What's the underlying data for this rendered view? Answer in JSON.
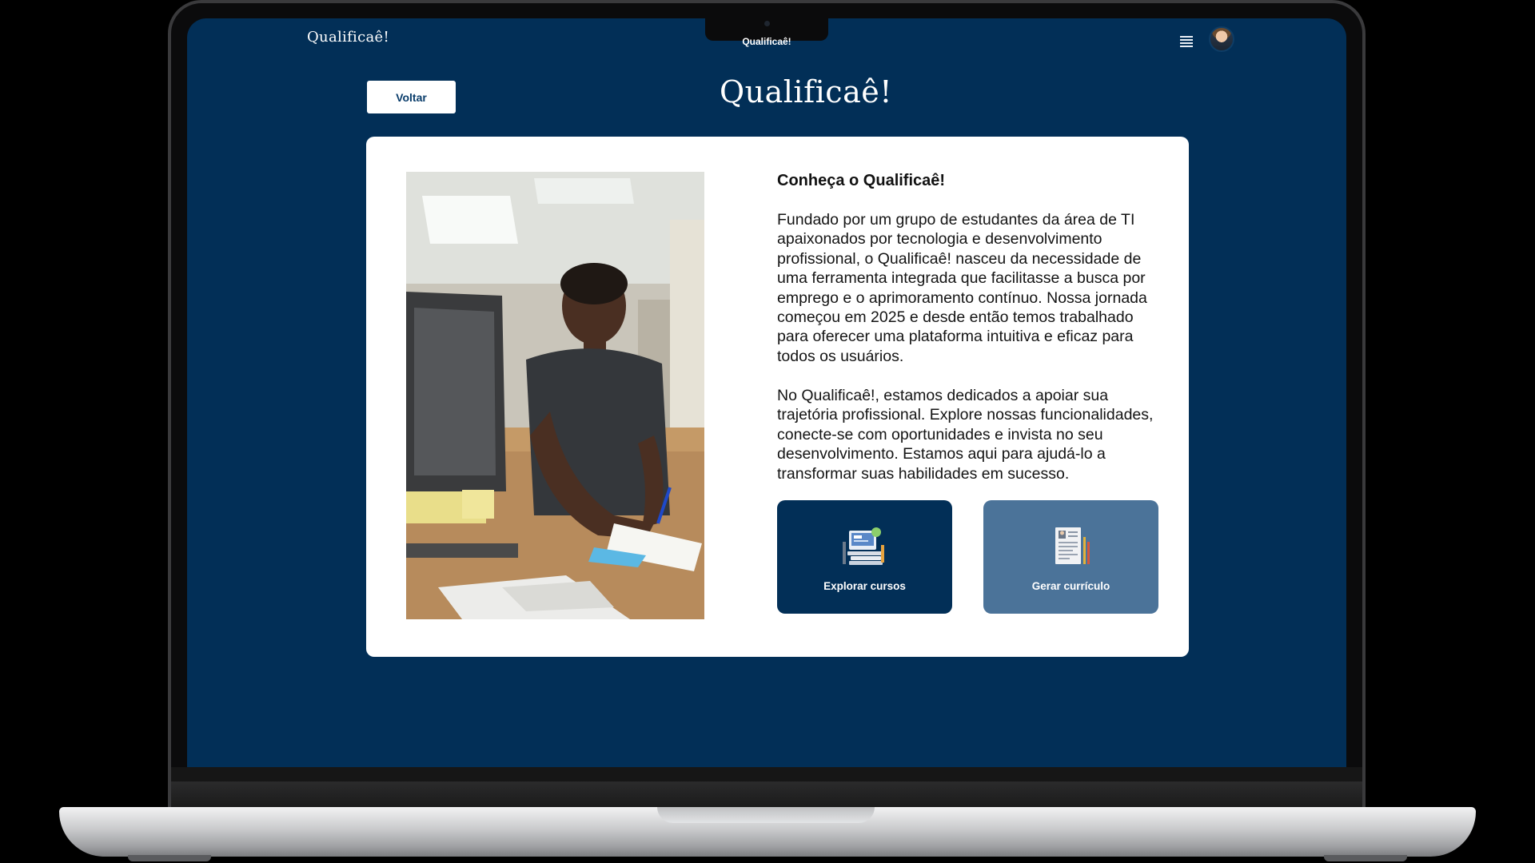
{
  "app": {
    "brand": "Qualificaê!",
    "window_title": "Qualificaê!"
  },
  "header": {
    "menu_icon": "hamburger-menu-icon",
    "avatar_icon": "user-avatar"
  },
  "nav": {
    "back_label": "Voltar"
  },
  "logo": {
    "text": "Qualificaê!"
  },
  "about": {
    "title": "Conheça o Qualificaê!",
    "paragraph_1": "Fundado por um grupo de estudantes da área de TI apaixonados por tecnologia e desenvolvimento profissional, o Qualificaê! nasceu da necessidade de uma ferramenta integrada que facilitasse a busca por emprego e o aprimoramento contínuo. Nossa jornada começou em 2025 e desde então temos trabalhado para oferecer uma plataforma intuitiva e eficaz para todos os usuários.",
    "paragraph_2": "No Qualificaê!, estamos dedicados a apoiar sua trajetória profissional. Explore nossas funcionalidades, conecte-se com oportunidades e invista no seu desenvolvimento. Estamos aqui para ajudá-lo a transformar suas habilidades em sucesso.",
    "photo_subject": "student-writing-at-desk-photo"
  },
  "actions": [
    {
      "label": "Explorar cursos",
      "icon": "courses-icon",
      "color": "#022f57"
    },
    {
      "label": "Gerar currículo",
      "icon": "resume-icon",
      "color": "#4b7399"
    }
  ],
  "colors": {
    "background": "#022f57",
    "card": "#ffffff",
    "primary": "#022f57",
    "secondary": "#4b7399",
    "back_button_text": "#0a3d6b"
  }
}
